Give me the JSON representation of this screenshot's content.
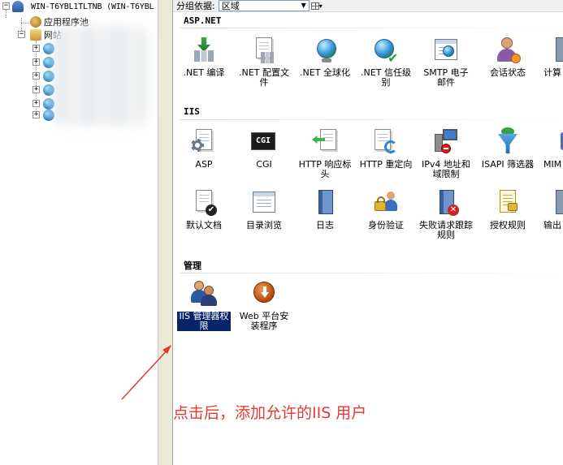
{
  "tree": {
    "server_label": "WIN-T6YBL1TLTNB (WIN-T6YBL",
    "app_pools_label": "应用程序池",
    "sites_label": "网站",
    "expander_collapsed": "+",
    "expander_expanded": "−"
  },
  "toolbar": {
    "group_by_label": "分组依据:",
    "group_by_value": "区域"
  },
  "groups": {
    "aspnet": {
      "title": "ASP.NET",
      "items": [
        {
          "label": ".NET 编译",
          "icon": "net-compilation-icon"
        },
        {
          "label": ".NET 配置文件",
          "icon": "net-profile-icon"
        },
        {
          "label": ".NET 全球化",
          "icon": "net-globalization-icon"
        },
        {
          "label": ".NET 信任级别",
          "icon": "net-trust-levels-icon"
        },
        {
          "label": "SMTP 电子邮件",
          "icon": "smtp-email-icon"
        },
        {
          "label": "会话状态",
          "icon": "session-state-icon"
        },
        {
          "label": "计算",
          "icon": "machine-key-icon"
        }
      ]
    },
    "iis": {
      "title": "IIS",
      "items": [
        {
          "label": "ASP",
          "icon": "asp-icon"
        },
        {
          "label": "CGI",
          "icon": "cgi-icon"
        },
        {
          "label": "HTTP 响应标头",
          "icon": "http-response-headers-icon"
        },
        {
          "label": "HTTP 重定向",
          "icon": "http-redirect-icon"
        },
        {
          "label": "IPv4 地址和域限制",
          "icon": "ipv4-restrictions-icon"
        },
        {
          "label": "ISAPI 筛选器",
          "icon": "isapi-filters-icon"
        },
        {
          "label": "MIM",
          "icon": "mime-types-icon"
        },
        {
          "label": "默认文档",
          "icon": "default-document-icon"
        },
        {
          "label": "目录浏览",
          "icon": "directory-browsing-icon"
        },
        {
          "label": "日志",
          "icon": "logging-icon"
        },
        {
          "label": "身份验证",
          "icon": "authentication-icon"
        },
        {
          "label": "失败请求跟踪规则",
          "icon": "failed-request-tracing-icon"
        },
        {
          "label": "授权规则",
          "icon": "authorization-rules-icon"
        },
        {
          "label": "输出",
          "icon": "output-caching-icon"
        }
      ]
    },
    "management": {
      "title": "管理",
      "items": [
        {
          "label": "IIS 管理器权限",
          "icon": "iis-manager-permissions-icon"
        },
        {
          "label": "Web 平台安装程序",
          "icon": "web-platform-installer-icon"
        }
      ]
    }
  },
  "annotation": {
    "text": "点击后，添加允许的IIS 用户",
    "color": "#e53935"
  },
  "colors": {
    "selection": "#0a246a",
    "splitter": "#ece9d8"
  }
}
